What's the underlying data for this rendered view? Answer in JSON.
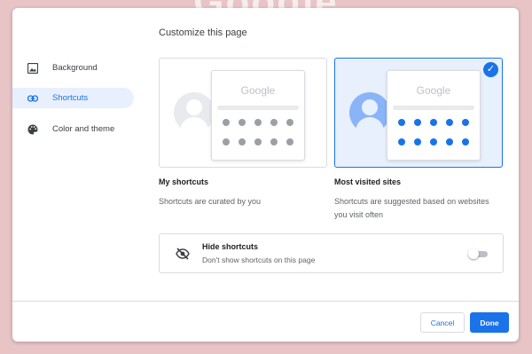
{
  "background": {
    "logo_text": "Google"
  },
  "dialog": {
    "title": "Customize this page",
    "nav": [
      {
        "label": "Background",
        "icon": "image-icon"
      },
      {
        "label": "Shortcuts",
        "icon": "link-icon",
        "active": true
      },
      {
        "label": "Color and theme",
        "icon": "palette-icon"
      }
    ],
    "options": [
      {
        "logo": "Google",
        "title": "My shortcuts",
        "desc": "Shortcuts are curated by you",
        "selected": false
      },
      {
        "logo": "Google",
        "title": "Most visited sites",
        "desc": "Shortcuts are suggested based on websites you visit often",
        "selected": true
      }
    ],
    "hide": {
      "title": "Hide shortcuts",
      "desc": "Don't show shortcuts on this page",
      "enabled": false
    },
    "buttons": {
      "cancel": "Cancel",
      "done": "Done"
    }
  },
  "colors": {
    "accent": "#1a73e8",
    "selected_bg": "#e8f0fe",
    "backdrop": "#e8c4c6"
  }
}
